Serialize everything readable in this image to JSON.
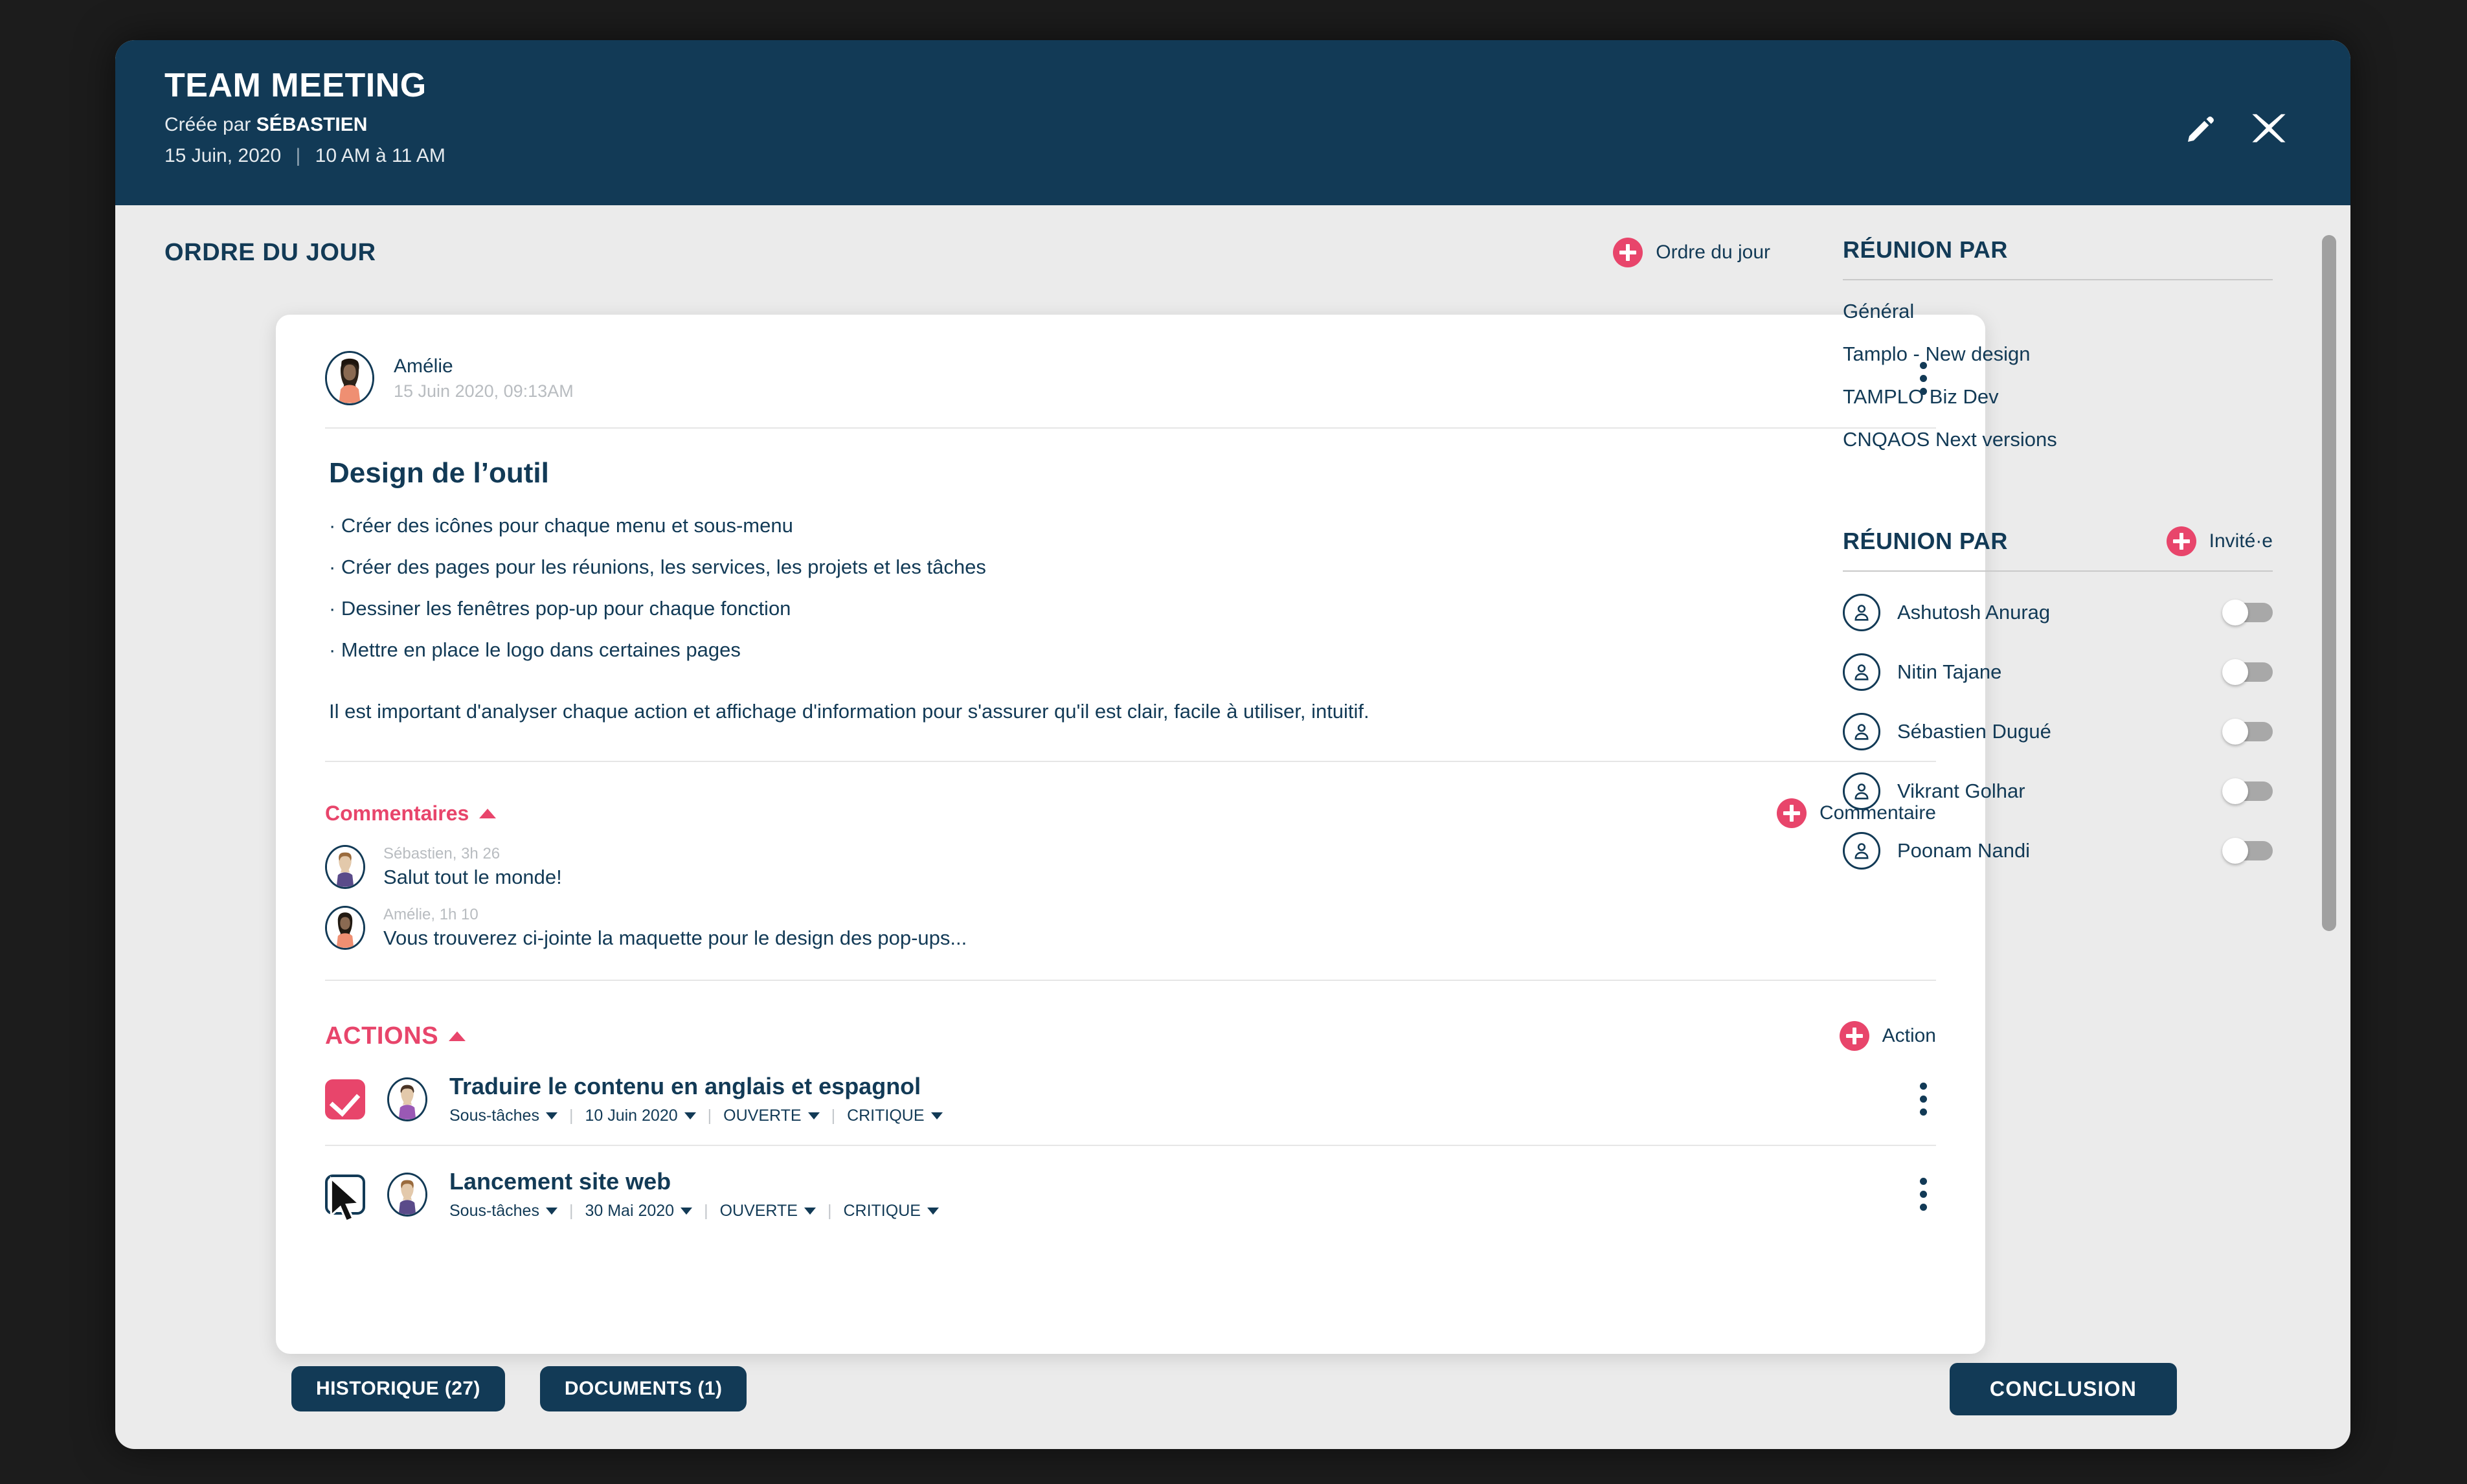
{
  "header": {
    "title": "TEAM MEETING",
    "created_prefix": "Créée par ",
    "creator": "SÉBASTIEN",
    "date": "15 Juin, 2020",
    "time": "10 AM à 11 AM",
    "edit_icon": "pencil-icon",
    "close_icon": "close-icon"
  },
  "agenda": {
    "section_title": "ORDRE DU JOUR",
    "add_label": "Ordre du jour",
    "author": "Amélie",
    "author_time": "15 Juin 2020, 09:13AM",
    "item_title": "Design de l’outil",
    "bullets": [
      "· Créer des icônes pour chaque menu et sous-menu",
      "· Créer des pages pour les réunions, les services, les projets et les tâches",
      "· Dessiner les fenêtres pop-up pour chaque fonction",
      "· Mettre en place le logo dans certaines pages"
    ],
    "note": "Il est important d'analyser chaque action et affichage d'information pour s'assurer qu'il est clair, facile à utiliser, intuitif."
  },
  "comments": {
    "label": "Commentaires",
    "add_label": "Commentaire",
    "items": [
      {
        "meta": "Sébastien, 3h 26",
        "text": "Salut tout le monde!"
      },
      {
        "meta": "Amélie, 1h 10",
        "text": "Vous trouverez ci-jointe la maquette pour le design des pop-ups..."
      }
    ]
  },
  "actions": {
    "label": "ACTIONS",
    "add_label": "Action",
    "items": [
      {
        "checked": true,
        "title": "Traduire le contenu en anglais et espagnol",
        "subtasks": "Sous-tâches",
        "date": "10 Juin 2020",
        "status": "OUVERTE",
        "priority": "CRITIQUE"
      },
      {
        "checked": false,
        "title": "Lancement site web",
        "subtasks": "Sous-tâches",
        "date": "30 Mai 2020",
        "status": "OUVERTE",
        "priority": "CRITIQUE"
      }
    ],
    "separator": "|"
  },
  "groups": {
    "title": "RÉUNION PAR",
    "items": [
      "Général",
      "Tamplo - New design",
      "TAMPLO Biz Dev",
      "CNQAOS Next versions"
    ]
  },
  "invitees": {
    "title": "RÉUNION PAR",
    "add_label": "Invité·e",
    "items": [
      {
        "name": "Ashutosh Anurag",
        "enabled": false
      },
      {
        "name": "Nitin Tajane",
        "enabled": false
      },
      {
        "name": "Sébastien Dugué",
        "enabled": false
      },
      {
        "name": "Vikrant Golhar",
        "enabled": false
      },
      {
        "name": "Poonam Nandi",
        "enabled": false
      }
    ]
  },
  "footer": {
    "history_label": "HISTORIQUE (27)",
    "documents_label": "DOCUMENTS (1)",
    "conclusion_label": "CONCLUSION"
  },
  "colors": {
    "navy": "#123a56",
    "pink": "#e8456b",
    "panel_bg": "#ebebeb",
    "card_bg": "#ffffff",
    "desktop_bg": "#1c1c1c"
  }
}
